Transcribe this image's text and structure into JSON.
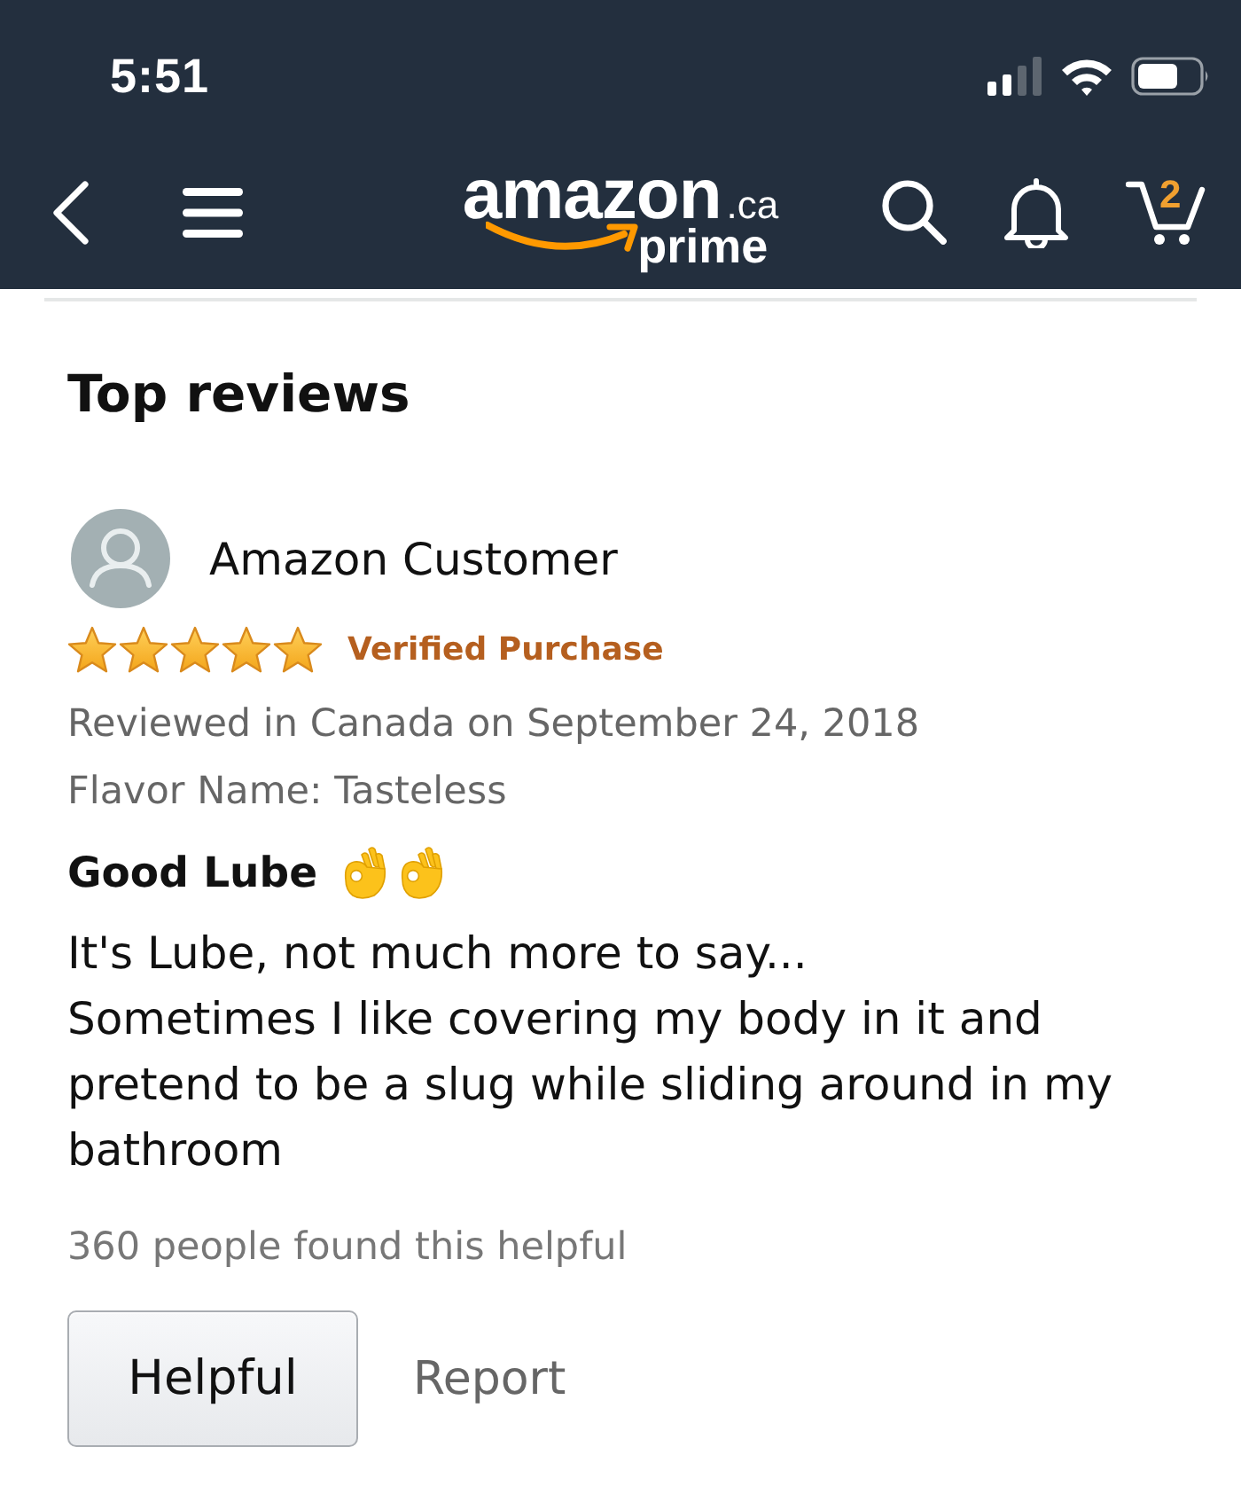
{
  "status_bar": {
    "time": "5:51"
  },
  "nav_bar": {
    "logo": {
      "wordmark": "amazon",
      "domain": ".ca",
      "tier": "prime"
    },
    "cart_count": "2"
  },
  "section": {
    "title": "Top reviews"
  },
  "review": {
    "author": "Amazon Customer",
    "stars": 5,
    "badge": "Verified Purchase",
    "meta": "Reviewed in Canada on September 24, 2018",
    "variant": "Flavor Name: Tasteless",
    "title": "Good Lube",
    "title_icons": [
      {
        "kind": "ok-hand"
      },
      {
        "kind": "ok-hand"
      }
    ],
    "body": [
      "It's Lube, not much more to say...",
      "Sometimes I like covering my body in it and pretend to be a slug while sliding around in my bathroom"
    ],
    "helpful_count": "360 people found this helpful",
    "actions": [
      {
        "kind": "button",
        "label": "Helpful"
      },
      {
        "kind": "link",
        "label": "Report"
      }
    ]
  }
}
